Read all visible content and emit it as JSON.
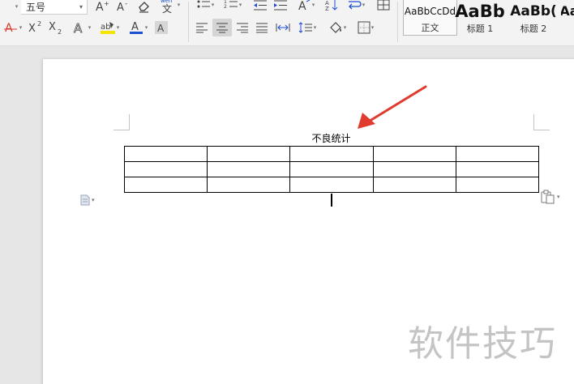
{
  "ribbon": {
    "font_size_value": "五号",
    "row1": [
      {
        "name": "grow-font-button",
        "glyph": "A⁺"
      },
      {
        "name": "shrink-font-button",
        "glyph": "A⁻"
      },
      {
        "name": "clear-format-button",
        "glyph": "◇"
      },
      {
        "name": "pinyin-guide-button",
        "glyph": "wén",
        "sub": "文"
      }
    ],
    "row2_font": [
      {
        "name": "text-effect-button",
        "glyph": "A"
      },
      {
        "name": "superscript-button",
        "glyph": "X²"
      },
      {
        "name": "subscript-button",
        "glyph": "X₂"
      },
      {
        "name": "outline-text-button",
        "glyph": "Ⓐ"
      },
      {
        "name": "highlight-button",
        "glyph": "ab"
      },
      {
        "name": "font-color-button",
        "glyph": "A"
      },
      {
        "name": "char-shading-button",
        "glyph": "A"
      }
    ],
    "colors": {
      "red": "#d9342b",
      "yellow": "#f5e300",
      "blue": "#1f4fd1"
    }
  },
  "styles": [
    {
      "preview": "AaBbCcDd",
      "name": "正文"
    },
    {
      "preview": "AaBb",
      "name": "标题 1"
    },
    {
      "preview": "AaBb(",
      "name": "标题 2"
    },
    {
      "preview": "Aa",
      "name": ""
    }
  ],
  "document": {
    "title": "不良统计",
    "table": {
      "rows": 3,
      "cols": 5
    }
  },
  "watermark": "软件技巧"
}
